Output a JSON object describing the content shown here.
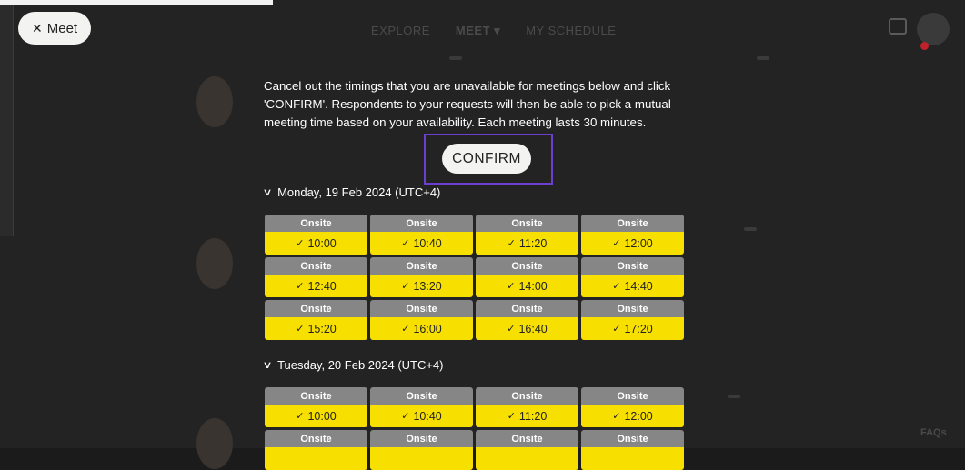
{
  "back_button": {
    "label": "Meet",
    "icon": "close-icon"
  },
  "nav": {
    "explore": "EXPLORE",
    "meet": "MEET",
    "meet_caret": "▾",
    "my_schedule": "MY SCHEDULE"
  },
  "footer": {
    "faqs": "FAQs"
  },
  "dialog": {
    "instructions": "Cancel out the timings that you are unavailable for meetings below and click 'CONFIRM'. Respondents to your requests will then be able to pick a mutual meeting time based on your availability. Each meeting lasts 30 minutes.",
    "confirm_label": "CONFIRM",
    "days": [
      {
        "label": "Monday, 19 Feb 2024 (UTC+4)",
        "slots": [
          {
            "type": "Onsite",
            "time": "10:00"
          },
          {
            "type": "Onsite",
            "time": "10:40"
          },
          {
            "type": "Onsite",
            "time": "11:20"
          },
          {
            "type": "Onsite",
            "time": "12:00"
          },
          {
            "type": "Onsite",
            "time": "12:40"
          },
          {
            "type": "Onsite",
            "time": "13:20"
          },
          {
            "type": "Onsite",
            "time": "14:00"
          },
          {
            "type": "Onsite",
            "time": "14:40"
          },
          {
            "type": "Onsite",
            "time": "15:20"
          },
          {
            "type": "Onsite",
            "time": "16:00"
          },
          {
            "type": "Onsite",
            "time": "16:40"
          },
          {
            "type": "Onsite",
            "time": "17:20"
          }
        ]
      },
      {
        "label": "Tuesday, 20 Feb 2024 (UTC+4)",
        "slots": [
          {
            "type": "Onsite",
            "time": "10:00"
          },
          {
            "type": "Onsite",
            "time": "10:40"
          },
          {
            "type": "Onsite",
            "time": "11:20"
          },
          {
            "type": "Onsite",
            "time": "12:00"
          },
          {
            "type": "Onsite",
            "time": ""
          },
          {
            "type": "Onsite",
            "time": ""
          },
          {
            "type": "Onsite",
            "time": ""
          },
          {
            "type": "Onsite",
            "time": ""
          }
        ]
      }
    ]
  },
  "colors": {
    "slot_header": "#868686",
    "slot_available": "#f7e000",
    "focus_outline": "#6b3fd0"
  }
}
